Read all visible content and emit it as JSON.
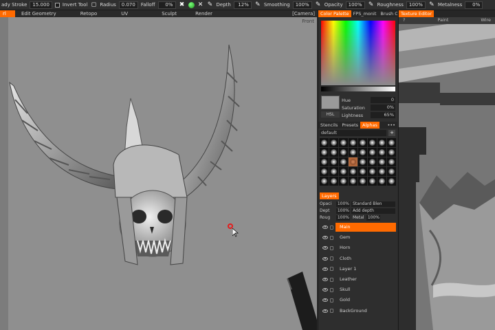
{
  "toolbar": {
    "stroke_label": "ady Stroke",
    "stroke_value": "15.000",
    "invert_label": "Invert Tool",
    "radius_label": "Radius",
    "radius_value": "0.070",
    "falloff_label": "Falloff",
    "falloff_value": "0%",
    "depth_label": "Depth",
    "depth_value": "12%",
    "smoothing_label": "Smoothing",
    "smoothing_value": "100%",
    "opacity_label": "Opacity",
    "opacity_value": "100%",
    "roughness_label": "Roughness",
    "roughness_value": "100%",
    "metalness_label": "Metalness",
    "metalness_value": "0%",
    "camera_label": "[Camera]"
  },
  "rooms": {
    "active": "rl",
    "items": [
      "Edit Geometry",
      "Retopo",
      "UV",
      "Sculpt",
      "Render"
    ]
  },
  "viewport": {
    "view_label": "Front"
  },
  "panel": {
    "tabs": [
      "Color Palette",
      "FPS_monit",
      "Brush Opt"
    ],
    "hsl_button": "HSL",
    "hue_label": "Hue",
    "hue_value": "0",
    "saturation_label": "Saturation",
    "saturation_value": "0%",
    "lightness_label": "Lightness",
    "lightness_value": "65%",
    "stencil_tabs": [
      "Stencils",
      "Presets",
      "Alphas"
    ],
    "stencil_more": "•••",
    "preset_select": "default",
    "plus": "+",
    "layers_tab": "Layers",
    "opacity_label": "Opaci",
    "opacity_value": "100%",
    "blend_select": "Standard Blen",
    "depth_label": "Dept",
    "depth_value": "100%",
    "depth_mode": "Add depth",
    "rough_label": "Roug",
    "rough_value": "100%",
    "metal_label": "Metal",
    "metal_value": "100%",
    "layers": [
      "Main",
      "Gem",
      "Horn",
      "Cloth",
      "Layer 1",
      "Leather",
      "Skull",
      "Gold",
      "BackGround"
    ]
  },
  "texture_editor": {
    "tab": "Texture Editor",
    "sub_left": "?",
    "sub_mid": "Paint",
    "sub_right": "Wire"
  },
  "colors": {
    "accent": "#ff6a00",
    "viewport_bg": "#8f8f8f",
    "panel_bg": "#2e2e2e"
  }
}
